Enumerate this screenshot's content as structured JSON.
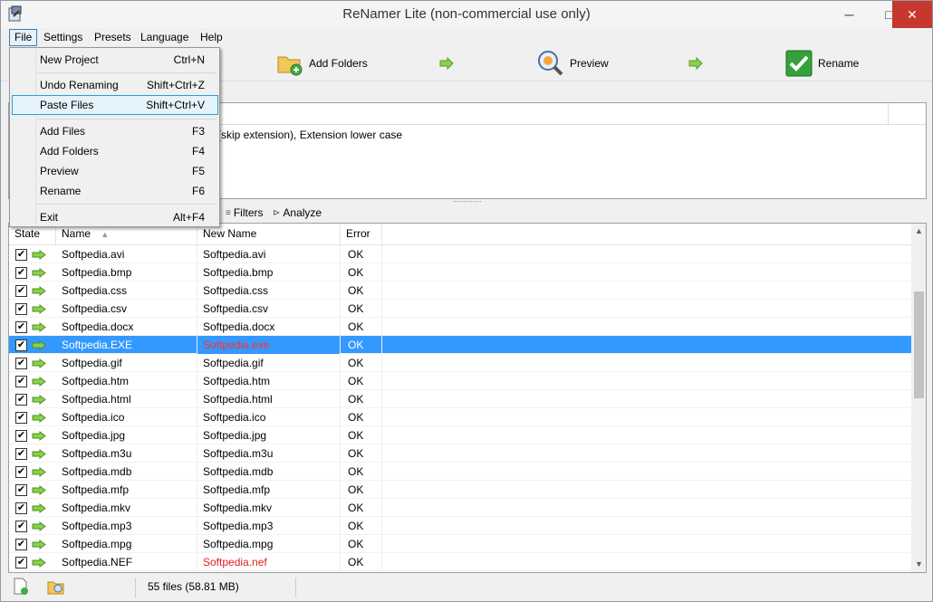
{
  "window": {
    "title": "ReNamer Lite (non-commercial use only)"
  },
  "menubar": {
    "items": [
      "File",
      "Settings",
      "Presets",
      "Language",
      "Help"
    ]
  },
  "toolbar": {
    "add_folders": "Add Folders",
    "preview": "Preview",
    "rename": "Rename"
  },
  "rules": {
    "text": "d (skip extension), Extension lower case"
  },
  "filebar": {
    "filters": "Filters",
    "analyze": "Analyze"
  },
  "grid": {
    "headers": {
      "state": "State",
      "name": "Name",
      "new_name": "New Name",
      "error": "Error"
    },
    "rows": [
      {
        "name": "Softpedia.avi",
        "new_name": "Softpedia.avi",
        "error": "OK"
      },
      {
        "name": "Softpedia.bmp",
        "new_name": "Softpedia.bmp",
        "error": "OK"
      },
      {
        "name": "Softpedia.css",
        "new_name": "Softpedia.css",
        "error": "OK"
      },
      {
        "name": "Softpedia.csv",
        "new_name": "Softpedia.csv",
        "error": "OK"
      },
      {
        "name": "Softpedia.docx",
        "new_name": "Softpedia.docx",
        "error": "OK"
      },
      {
        "name": "Softpedia.EXE",
        "new_name": "Softpedia.exe",
        "error": "OK",
        "selected": true,
        "changed": true
      },
      {
        "name": "Softpedia.gif",
        "new_name": "Softpedia.gif",
        "error": "OK"
      },
      {
        "name": "Softpedia.htm",
        "new_name": "Softpedia.htm",
        "error": "OK"
      },
      {
        "name": "Softpedia.html",
        "new_name": "Softpedia.html",
        "error": "OK"
      },
      {
        "name": "Softpedia.ico",
        "new_name": "Softpedia.ico",
        "error": "OK"
      },
      {
        "name": "Softpedia.jpg",
        "new_name": "Softpedia.jpg",
        "error": "OK"
      },
      {
        "name": "Softpedia.m3u",
        "new_name": "Softpedia.m3u",
        "error": "OK"
      },
      {
        "name": "Softpedia.mdb",
        "new_name": "Softpedia.mdb",
        "error": "OK"
      },
      {
        "name": "Softpedia.mfp",
        "new_name": "Softpedia.mfp",
        "error": "OK"
      },
      {
        "name": "Softpedia.mkv",
        "new_name": "Softpedia.mkv",
        "error": "OK"
      },
      {
        "name": "Softpedia.mp3",
        "new_name": "Softpedia.mp3",
        "error": "OK"
      },
      {
        "name": "Softpedia.mpg",
        "new_name": "Softpedia.mpg",
        "error": "OK"
      },
      {
        "name": "Softpedia.NEF",
        "new_name": "Softpedia.nef",
        "error": "OK",
        "changed": true
      }
    ]
  },
  "status": {
    "text": "55 files (58.81 MB)"
  },
  "file_menu": {
    "items": [
      {
        "label": "New Project",
        "shortcut": "Ctrl+N"
      },
      {
        "label": "Undo Renaming",
        "shortcut": "Shift+Ctrl+Z"
      },
      {
        "label": "Paste Files",
        "shortcut": "Shift+Ctrl+V",
        "highlighted": true
      },
      {
        "label": "Add Files",
        "shortcut": "F3"
      },
      {
        "label": "Add Folders",
        "shortcut": "F4"
      },
      {
        "label": "Preview",
        "shortcut": "F5"
      },
      {
        "label": "Rename",
        "shortcut": "F6"
      },
      {
        "label": "Exit",
        "shortcut": "Alt+F4"
      }
    ]
  },
  "colors": {
    "selection": "#3399ff",
    "changed_name": "#e02020",
    "close_button": "#c7372f"
  }
}
